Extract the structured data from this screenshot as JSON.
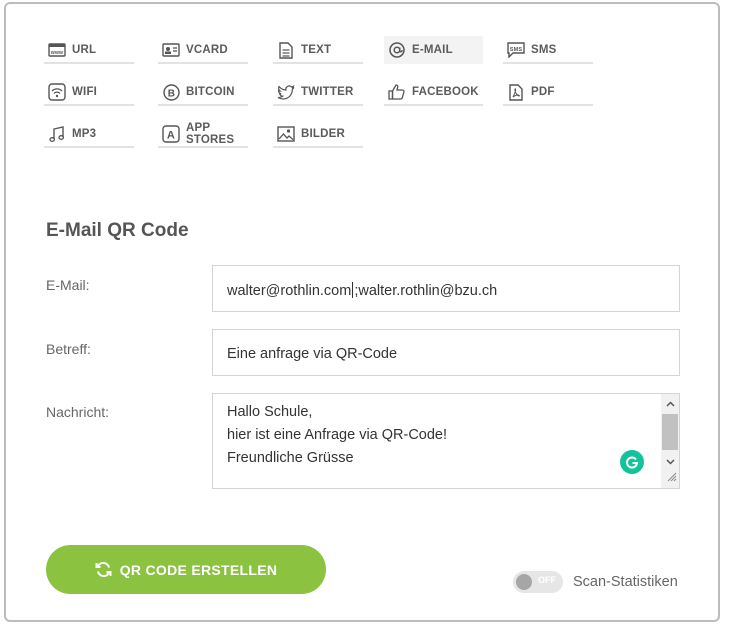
{
  "tabs": [
    {
      "label": "URL",
      "icon": "www-icon"
    },
    {
      "label": "VCARD",
      "icon": "vcard-icon"
    },
    {
      "label": "TEXT",
      "icon": "text-file-icon"
    },
    {
      "label": "E-MAIL",
      "icon": "at-icon",
      "active": true
    },
    {
      "label": "SMS",
      "icon": "sms-icon"
    },
    {
      "label": "WIFI",
      "icon": "wifi-icon"
    },
    {
      "label": "BITCOIN",
      "icon": "bitcoin-icon"
    },
    {
      "label": "TWITTER",
      "icon": "twitter-icon"
    },
    {
      "label": "FACEBOOK",
      "icon": "thumbs-up-icon"
    },
    {
      "label": "PDF",
      "icon": "pdf-icon"
    },
    {
      "label": "MP3",
      "icon": "music-note-icon"
    },
    {
      "label": "APP STORES",
      "icon": "app-store-icon"
    },
    {
      "label": "BILDER",
      "icon": "image-icon"
    }
  ],
  "form": {
    "title": "E-Mail QR Code",
    "email_label": "E-Mail:",
    "email_value_a": "walter@rothlin.com",
    "email_value_b": ";walter.rothlin@bzu.ch",
    "subject_label": "Betreff:",
    "subject_value": "Eine anfrage via QR-Code",
    "message_label": "Nachricht:",
    "message_lines": [
      "Hallo Schule,",
      "hier ist eine Anfrage via QR-Code!",
      "Freundliche Grüsse"
    ]
  },
  "actions": {
    "create_label": "QR CODE ERSTELLEN",
    "toggle_state": "OFF",
    "scan_label": "Scan-Statistiken"
  },
  "colors": {
    "accent": "#8bc23f",
    "grammarly": "#15c39a"
  }
}
